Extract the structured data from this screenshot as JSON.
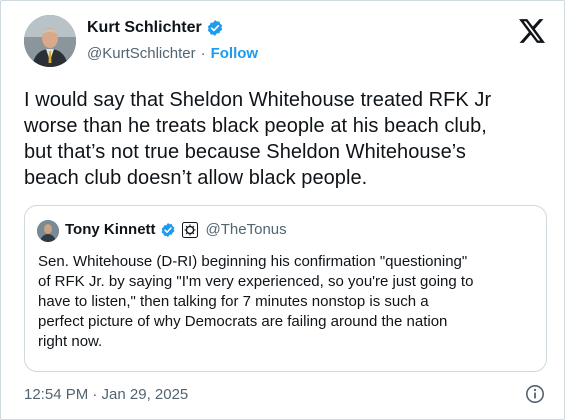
{
  "author": {
    "name": "Kurt Schlichter",
    "handle": "@KurtSchlichter",
    "separator": "·",
    "follow_label": "Follow"
  },
  "tweet": {
    "lines": [
      "I would say that Sheldon Whitehouse treated RFK Jr",
      "worse than he treats black people at his beach club,",
      "but that’s not true because Sheldon Whitehouse’s",
      "beach club doesn’t allow black people."
    ],
    "timestamp": "12:54 PM · Jan 29, 2025"
  },
  "quoted_tweet": {
    "name": "Tony Kinnett",
    "handle": "@TheTonus",
    "lines": [
      "Sen. Whitehouse (D-RI) beginning his confirmation \"questioning\"",
      "of RFK Jr. by saying \"I'm very experienced, so you're just going to",
      "have to listen,\" then talking for 7 minutes nonstop is such a",
      "perfect picture of why Democrats are failing around the nation",
      "right now."
    ]
  },
  "icons": {
    "verified": "verified-badge-icon",
    "platform": "x-logo-icon",
    "affiliate": "affiliate-badge-icon",
    "info": "info-icon"
  },
  "colors": {
    "accent": "#1d9bf0",
    "text": "#0f1419",
    "secondary_text": "#536471",
    "border": "#cfd9de"
  }
}
